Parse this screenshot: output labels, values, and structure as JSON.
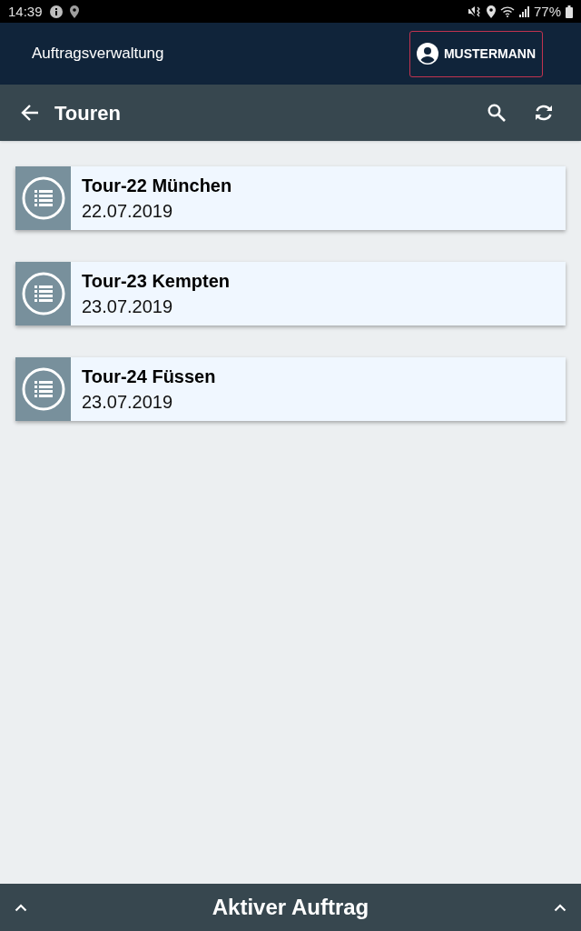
{
  "status_bar": {
    "time": "14:39",
    "battery": "77%"
  },
  "app_bar": {
    "title": "Auftragsverwaltung",
    "user_button": "MUSTERMANN"
  },
  "toolbar": {
    "title": "Touren"
  },
  "tours": [
    {
      "title": "Tour-22 München",
      "date": "22.07.2019"
    },
    {
      "title": "Tour-23 Kempten",
      "date": "23.07.2019"
    },
    {
      "title": "Tour-24 Füssen",
      "date": "23.07.2019"
    }
  ],
  "bottom_bar": {
    "title": "Aktiver Auftrag"
  }
}
